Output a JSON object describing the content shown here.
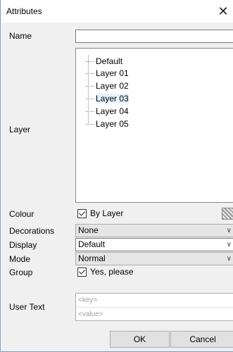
{
  "window": {
    "title": "Attributes"
  },
  "labels": {
    "name": "Name",
    "layer": "Layer",
    "colour": "Colour",
    "decorations": "Decorations",
    "display": "Display",
    "mode": "Mode",
    "group": "Group",
    "user_text": "User Text"
  },
  "name_value": "",
  "layer_tree": [
    "Default",
    "Layer 01",
    "Layer 02",
    "Layer 03",
    "Layer 04",
    "Layer 05"
  ],
  "layer_selected": "Layer 03",
  "colour": {
    "checkbox_label": "By Layer",
    "checked": true
  },
  "decorations": {
    "value": "None"
  },
  "display": {
    "value": "Default"
  },
  "mode": {
    "value": "Normal"
  },
  "group": {
    "checkbox_label": "Yes, please",
    "checked": true
  },
  "user_text": {
    "key_placeholder": "<key>",
    "value_placeholder": "<value>"
  },
  "buttons": {
    "ok": "OK",
    "cancel": "Cancel"
  },
  "icons": {
    "close": "close-icon",
    "dropdown": "chevron-down-icon",
    "colour_swatch": "hatched-swatch-icon"
  }
}
